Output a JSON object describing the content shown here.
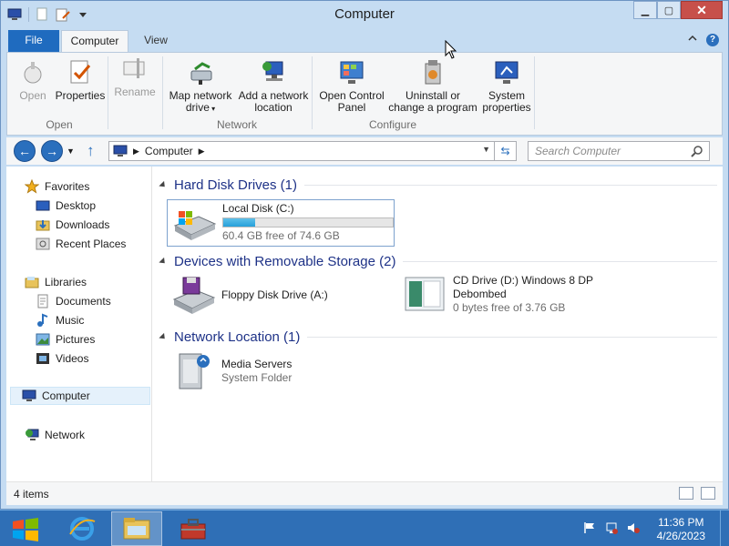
{
  "window": {
    "title": "Computer"
  },
  "ribbon_tabs": {
    "file": "File",
    "computer": "Computer",
    "view": "View"
  },
  "ribbon": {
    "groups": {
      "open": "Open",
      "network": "Network",
      "configure": "Configure"
    },
    "buttons": {
      "open": "Open",
      "properties": "Properties",
      "rename": "Rename",
      "map_network_drive": "Map network drive",
      "add_network_location": "Add a network location",
      "open_control_panel": "Open Control Panel",
      "uninstall_program": "Uninstall or change a program",
      "system_properties": "System properties"
    }
  },
  "address": {
    "crumb": "Computer",
    "search_placeholder": "Search Computer"
  },
  "navpane": {
    "favorites": "Favorites",
    "desktop": "Desktop",
    "downloads": "Downloads",
    "recent_places": "Recent Places",
    "libraries": "Libraries",
    "documents": "Documents",
    "music": "Music",
    "pictures": "Pictures",
    "videos": "Videos",
    "computer": "Computer",
    "network": "Network"
  },
  "sections": {
    "hdd": "Hard Disk Drives (1)",
    "removable": "Devices with Removable Storage (2)",
    "network": "Network Location (1)"
  },
  "drives": {
    "local_disk": {
      "name": "Local Disk (C:)",
      "free": "60.4 GB free of 74.6 GB",
      "used_fraction": 0.19
    },
    "floppy": {
      "name": "Floppy Disk Drive (A:)"
    },
    "cd": {
      "name_line1": "CD Drive (D:) Windows 8 DP",
      "name_line2": "Debombed",
      "free": "0 bytes free of 3.76 GB"
    },
    "media": {
      "name": "Media Servers",
      "type": "System Folder"
    }
  },
  "status": {
    "items": "4 items"
  },
  "taskbar": {
    "time": "11:36 PM",
    "date": "4/26/2023"
  },
  "colors": {
    "accent": "#1f6bbf",
    "section_title": "#1e3287",
    "taskbar": "#2f6fb6"
  }
}
